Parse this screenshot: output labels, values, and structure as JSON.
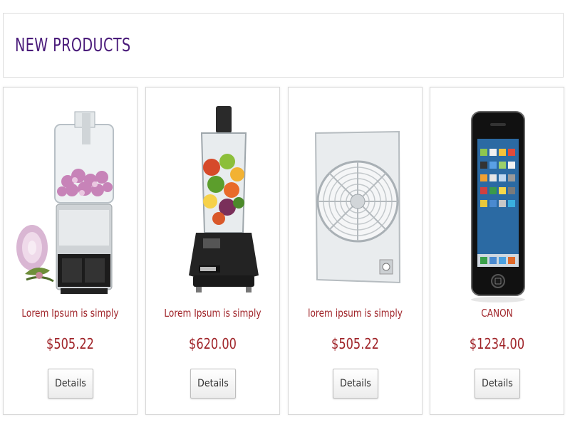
{
  "header": {
    "title": "NEW PRODUCTS"
  },
  "products": [
    {
      "image": "food-processor-image",
      "name": "Lorem Ipsum is simply",
      "price": "$505.22",
      "button_label": "Details"
    },
    {
      "image": "blender-image",
      "name": "Lorem Ipsum is simply",
      "price": "$620.00",
      "button_label": "Details"
    },
    {
      "image": "window-fan-image",
      "name": "lorem ipsum is simply",
      "price": "$505.22",
      "button_label": "Details"
    },
    {
      "image": "smartphone-image",
      "name": "CANON",
      "price": "$1234.00",
      "button_label": "Details"
    }
  ],
  "colors": {
    "title": "#4a1c7a",
    "accent": "#a0252a",
    "border": "#d8d8d8"
  }
}
